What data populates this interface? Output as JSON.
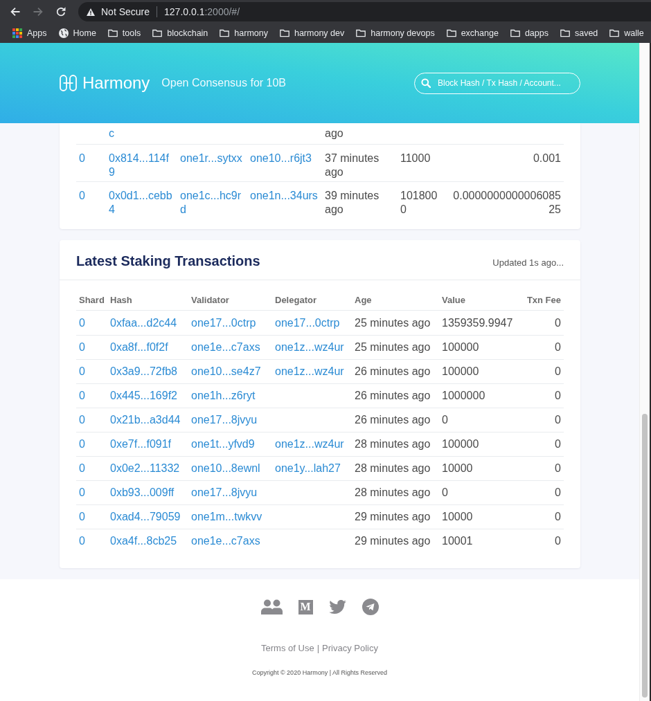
{
  "browser": {
    "nav_buttons": [
      {
        "kind": "back",
        "disabled": false
      },
      {
        "kind": "forward",
        "disabled": true
      },
      {
        "kind": "reload",
        "disabled": false
      }
    ],
    "security_label": "Not Secure",
    "url_host": "127.0.0.1",
    "url_path": ":2000/#/",
    "bookmarks": [
      {
        "kind": "apps",
        "label": "Apps"
      },
      {
        "kind": "site",
        "label": "Home"
      },
      {
        "kind": "folder",
        "label": "tools"
      },
      {
        "kind": "folder",
        "label": "blockchain"
      },
      {
        "kind": "folder",
        "label": "harmony"
      },
      {
        "kind": "folder",
        "label": "harmony dev"
      },
      {
        "kind": "folder",
        "label": "harmony devops"
      },
      {
        "kind": "folder",
        "label": "exchange"
      },
      {
        "kind": "folder",
        "label": "dapps"
      },
      {
        "kind": "folder",
        "label": "saved"
      },
      {
        "kind": "folder",
        "label": "walle"
      }
    ]
  },
  "header": {
    "brand": "Harmony",
    "tagline": "Open Consensus for 10B",
    "search": {
      "placeholder": "Block Hash / Tx Hash / Account..."
    }
  },
  "transactions_table": {
    "partial_row": {
      "column_2": "c",
      "column_5": "ago"
    },
    "rows": [
      {
        "cells": [
          "0",
          "0x814...114f9",
          "one1r...sytxx",
          "one10...r6jt3",
          "37 minutes ago",
          "11000",
          "0.001"
        ]
      },
      {
        "cells": [
          "0",
          "0x0d1...cebb4",
          "one1c...hc9rd",
          "one1n...34urs",
          "39 minutes ago",
          "1018000",
          "0.000000000000608525"
        ]
      }
    ]
  },
  "staking_transactions": {
    "title": "Latest Staking Transactions",
    "updated": "Updated 1s ago...",
    "columns": [
      "Shard",
      "Hash",
      "Validator",
      "Delegator",
      "Age",
      "Value",
      "Txn Fee"
    ],
    "rows": [
      {
        "shard": "0",
        "hash": "0xfaa...d2c44",
        "validator": "one17...0ctrp",
        "delegator": "one17...0ctrp",
        "age": "25 minutes ago",
        "value": "1359359.9947",
        "txn_fee": "0"
      },
      {
        "shard": "0",
        "hash": "0xa8f...f0f2f",
        "validator": "one1e...c7axs",
        "delegator": "one1z...wz4ur",
        "age": "25 minutes ago",
        "value": "100000",
        "txn_fee": "0"
      },
      {
        "shard": "0",
        "hash": "0x3a9...72fb8",
        "validator": "one10...se4z7",
        "delegator": "one1z...wz4ur",
        "age": "26 minutes ago",
        "value": "100000",
        "txn_fee": "0"
      },
      {
        "shard": "0",
        "hash": "0x445...169f2",
        "validator": "one1h...z6ryt",
        "age": "26 minutes ago",
        "value": "1000000",
        "txn_fee": "0"
      },
      {
        "shard": "0",
        "hash": "0x21b...a3d44",
        "validator": "one17...8jvyu",
        "age": "26 minutes ago",
        "value": "0",
        "txn_fee": "0"
      },
      {
        "shard": "0",
        "hash": "0xe7f...f091f",
        "validator": "one1t...yfvd9",
        "delegator": "one1z...wz4ur",
        "age": "28 minutes ago",
        "value": "100000",
        "txn_fee": "0"
      },
      {
        "shard": "0",
        "hash": "0x0e2...11332",
        "validator": "one10...8ewnl",
        "delegator": "one1y...lah27",
        "age": "28 minutes ago",
        "value": "10000",
        "txn_fee": "0"
      },
      {
        "shard": "0",
        "hash": "0xb93...009ff",
        "validator": "one17...8jvyu",
        "age": "28 minutes ago",
        "value": "0",
        "txn_fee": "0"
      },
      {
        "shard": "0",
        "hash": "0xad4...79059",
        "validator": "one1m...twkvv",
        "age": "29 minutes ago",
        "value": "10000",
        "txn_fee": "0"
      },
      {
        "shard": "0",
        "hash": "0xa4f...8cb25",
        "validator": "one1e...c7axs",
        "age": "29 minutes ago",
        "value": "10001",
        "txn_fee": "0"
      }
    ]
  },
  "footer": {
    "social_links": [
      {
        "kind": "people"
      },
      {
        "kind": "letter_tile",
        "letter": "M"
      },
      {
        "kind": "bird"
      },
      {
        "kind": "plane"
      }
    ],
    "links": [
      "Terms of Use",
      "Privacy Policy"
    ],
    "separator": "|",
    "copyright": "Copyright © 2020 Harmony | All Rights Reserved"
  }
}
